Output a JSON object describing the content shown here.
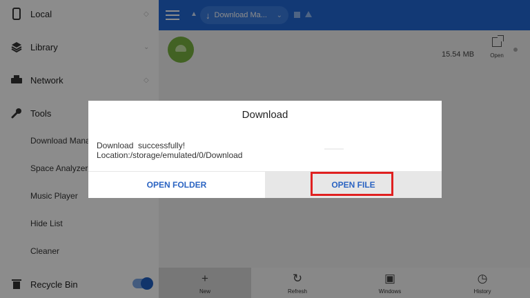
{
  "sidebar": {
    "items": [
      {
        "label": "Local",
        "icon": "phone-icon"
      },
      {
        "label": "Library",
        "icon": "stack-icon"
      },
      {
        "label": "Network",
        "icon": "network-icon"
      },
      {
        "label": "Tools",
        "icon": "wrench-icon"
      }
    ],
    "tools_sub": [
      "Download Mana",
      "Space Analyzer",
      "Music Player",
      "Hide List",
      "Cleaner"
    ],
    "recycle": {
      "label": "Recycle Bin",
      "icon": "trash-icon",
      "toggle_on": true
    }
  },
  "header": {
    "breadcrumb": "Download Ma...",
    "accent": "#2168d6"
  },
  "file": {
    "size": "15.54 MB",
    "open_label": "Open",
    "icon_color": "#78b340"
  },
  "toolbar": {
    "items": [
      {
        "label": "New",
        "icon": "plus-icon"
      },
      {
        "label": "Refresh",
        "icon": "refresh-icon"
      },
      {
        "label": "Windows",
        "icon": "windows-icon"
      },
      {
        "label": "History",
        "icon": "history-icon"
      }
    ]
  },
  "dialog": {
    "title": "Download",
    "message_line1": "Download  successfully!",
    "message_line2": "Location:/storage/emulated/0/Download",
    "open_folder": "OPEN FOLDER",
    "open_file": "OPEN FILE",
    "highlight_color": "#e02020"
  }
}
